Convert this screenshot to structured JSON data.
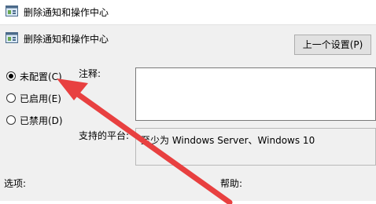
{
  "window": {
    "title": "删除通知和操作中心"
  },
  "header": {
    "title": "删除通知和操作中心",
    "prev_setting_label": "上一个设置(P)"
  },
  "options": {
    "items": [
      {
        "label": "未配置(C)",
        "checked": true
      },
      {
        "label": "已启用(E)",
        "checked": false
      },
      {
        "label": "已禁用(D)",
        "checked": false
      }
    ]
  },
  "comment": {
    "label": "注释:",
    "value": ""
  },
  "platform": {
    "label": "支持的平台:",
    "value": "至少为 Windows Server、Windows 10"
  },
  "footer": {
    "options_label": "选项:",
    "help_label": "帮助:"
  },
  "colors": {
    "annotation_arrow": "#e84040"
  }
}
